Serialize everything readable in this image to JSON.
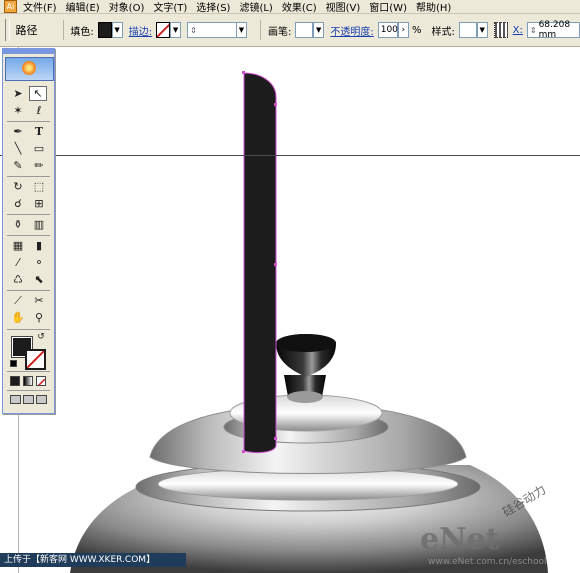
{
  "menubar": {
    "items": [
      "文件(F)",
      "编辑(E)",
      "对象(O)",
      "文字(T)",
      "选择(S)",
      "滤镜(L)",
      "效果(C)",
      "视图(V)",
      "窗口(W)",
      "帮助(H)"
    ]
  },
  "controlbar": {
    "path_label": "路径",
    "fill_label": "填色:",
    "stroke_label": "描边:",
    "brush_label": "画笔:",
    "opacity_label": "不透明度:",
    "opacity_value": "100",
    "opacity_unit": "%",
    "style_label": "样式:",
    "x_label": "X:",
    "x_value": "68.208 mm",
    "fill_color": "#1c1c1c"
  },
  "toolbox": {
    "tools": [
      "selection",
      "direct-selection",
      "magic-wand",
      "lasso",
      "pen",
      "type",
      "line-segment",
      "rectangle",
      "paintbrush",
      "pencil",
      "rotate",
      "scale",
      "warp",
      "free-transform",
      "symbol-sprayer",
      "column-graph",
      "mesh",
      "gradient",
      "eyedropper",
      "blend",
      "live-paint-bucket",
      "live-paint-selection",
      "slice",
      "scissors",
      "hand",
      "zoom"
    ]
  },
  "credits": {
    "bottom_left": "上传于【新客网 WWW.XKER.COM】",
    "watermark_logo": "eNet",
    "watermark_url": "www.eNet.com.cn/eschool",
    "watermark_cn": "硅谷动力"
  },
  "colors": {
    "handle_dark": "#1c1c1c",
    "selection_path": "#d04ed0",
    "ui_bg": "#ece9d8",
    "toolbox_border": "#7a96df"
  }
}
